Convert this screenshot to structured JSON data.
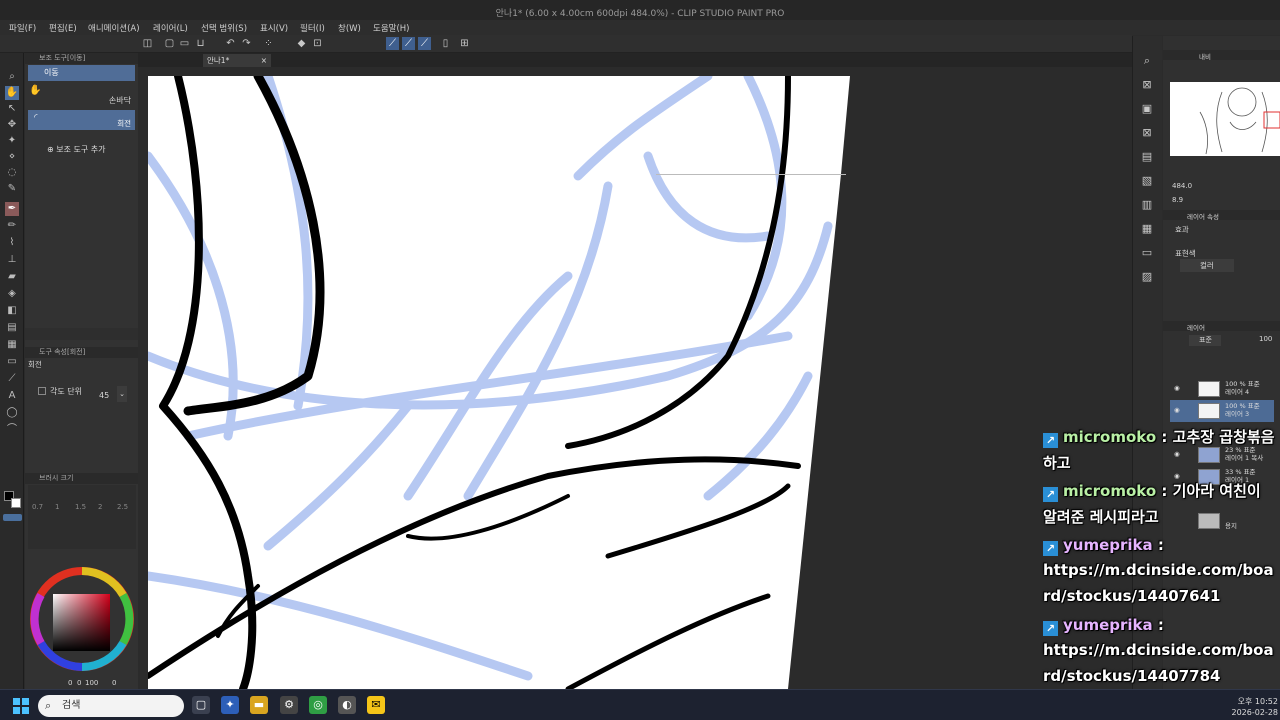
{
  "window": {
    "title": "안나1* (6.00 x 4.00cm 600dpi 484.0%) - CLIP STUDIO PAINT PRO"
  },
  "menu": [
    "파일(F)",
    "편집(E)",
    "애니메이션(A)",
    "레이어(L)",
    "선택 범위(S)",
    "표시(V)",
    "필터(I)",
    "창(W)",
    "도움말(H)"
  ],
  "tab": {
    "label": "안나1*"
  },
  "subtool": {
    "header": "보조 도구[이동]",
    "group_label": "이동",
    "item1": "손바닥",
    "item2": "회전",
    "add_label": "보조 도구 추가",
    "prop_header": "도구 속성[회전]",
    "prop_title": "회전",
    "angle_label": "각도 단위",
    "angle_value": "45",
    "brush_size_header": "브러시 크기",
    "brush_sizes": [
      "0.7",
      "1",
      "1.5",
      "2",
      "2.5"
    ]
  },
  "color": {
    "hue_value": "0",
    "sat_value": "0",
    "bright_value": "100",
    "alpha_value": "0"
  },
  "navigator": {
    "zoom": "484.0",
    "angle": "8.9",
    "tab": "내비"
  },
  "layer_prop": {
    "header": "레이어 속성",
    "effect_label": "효과",
    "expr_label": "표현색",
    "expr_value": "컬러"
  },
  "layers": {
    "header": "레이어",
    "blend": "표준",
    "opacity": "100",
    "items": [
      {
        "pct": "100 % 표준",
        "name": "레이어 4"
      },
      {
        "pct": "100 % 표준",
        "name": "레이어 3"
      },
      {
        "pct": "23 % 표준",
        "name": "레이어 1 복사"
      },
      {
        "pct": "33 % 표준",
        "name": "레이어 1"
      },
      {
        "pct": "",
        "name": "용지"
      }
    ]
  },
  "chat": [
    {
      "user": "micromoko",
      "text": "고추장 곱창볶음 하고"
    },
    {
      "user": "micromoko",
      "text": "기아라 여친이 알려준 레시피라고"
    },
    {
      "user": "yumeprika",
      "text": ""
    },
    {
      "user": "",
      "text": "https://m.dcinside.com/board/stockus/14407641"
    },
    {
      "user": "yumeprika",
      "text": ""
    },
    {
      "user": "",
      "text": "https://m.dcinside.com/board/stockus/14407784"
    },
    {
      "user": "yumeprika",
      "text": ""
    }
  ],
  "taskbar": {
    "search_placeholder": "검색",
    "time": "오후 10:52",
    "date": "2026-02-28"
  }
}
